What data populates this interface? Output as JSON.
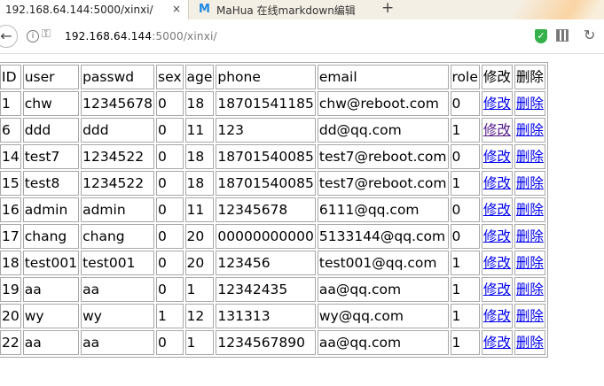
{
  "browser": {
    "tabs": [
      {
        "title": "192.168.64.144:5000/xinxi/",
        "active": true
      },
      {
        "title": "MaHua 在线markdown编辑",
        "active": false,
        "icon": "M"
      }
    ],
    "close_glyph": "×",
    "new_tab_glyph": "+",
    "back_glyph": "←",
    "info_glyph": "i",
    "key_glyph": "⚿",
    "refresh_glyph": "↻",
    "shield_glyph": "✓",
    "url_host": "192.168.64.144",
    "url_rest": ":5000/xinxi/"
  },
  "table": {
    "headers": [
      "ID",
      "user",
      "passwd",
      "sex",
      "age",
      "phone",
      "email",
      "role",
      "修改",
      "删除"
    ],
    "edit_label": "修改",
    "delete_label": "删除",
    "rows": [
      {
        "id": "1",
        "user": "chw",
        "passwd": "12345678",
        "sex": "0",
        "age": "18",
        "phone": "18701541185",
        "email": "chw@reboot.com",
        "role": "0"
      },
      {
        "id": "6",
        "user": "ddd",
        "passwd": "ddd",
        "sex": "0",
        "age": "11",
        "phone": "123",
        "email": "dd@qq.com",
        "role": "1"
      },
      {
        "id": "14",
        "user": "test7",
        "passwd": "1234522",
        "sex": "0",
        "age": "18",
        "phone": "18701540085",
        "email": "test7@reboot.com",
        "role": "0"
      },
      {
        "id": "15",
        "user": "test8",
        "passwd": "1234522",
        "sex": "0",
        "age": "18",
        "phone": "18701540085",
        "email": "test7@reboot.com",
        "role": "1"
      },
      {
        "id": "16",
        "user": "admin",
        "passwd": "admin",
        "sex": "0",
        "age": "11",
        "phone": "12345678",
        "email": "6111@qq.com",
        "role": "0"
      },
      {
        "id": "17",
        "user": "chang",
        "passwd": "chang",
        "sex": "0",
        "age": "20",
        "phone": "00000000000",
        "email": "5133144@qq.com",
        "role": "0"
      },
      {
        "id": "18",
        "user": "test001",
        "passwd": "test001",
        "sex": "0",
        "age": "20",
        "phone": "123456",
        "email": "test001@qq.com",
        "role": "1"
      },
      {
        "id": "19",
        "user": "aa",
        "passwd": "aa",
        "sex": "0",
        "age": "1",
        "phone": "12342435",
        "email": "aa@qq.com",
        "role": "1"
      },
      {
        "id": "20",
        "user": "wy",
        "passwd": "wy",
        "sex": "1",
        "age": "12",
        "phone": "131313",
        "email": "wy@qq.com",
        "role": "1"
      },
      {
        "id": "22",
        "user": "aa",
        "passwd": "aa",
        "sex": "0",
        "age": "1",
        "phone": "1234567890",
        "email": "aa@qq.com",
        "role": "1"
      }
    ]
  }
}
